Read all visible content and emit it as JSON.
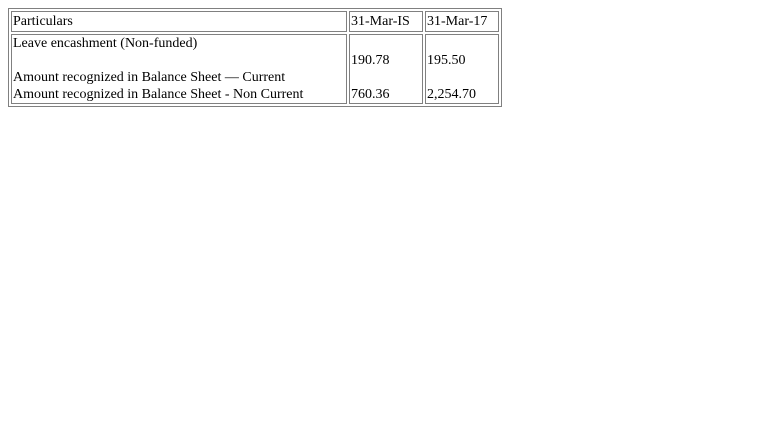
{
  "table": {
    "header": {
      "particulars": "Particulars",
      "col1": "31-Mar-IS",
      "col2": "31-Mar-17"
    },
    "section_label": "Leave encashment (Non-funded)",
    "rows": [
      {
        "label": "Amount recognized in Balance Sheet — Current",
        "col1": "190.78",
        "col2": "195.50"
      },
      {
        "label": "Amount recognized in Balance Sheet - Non Current",
        "col1": "760.36",
        "col2": "2,254.70"
      }
    ]
  }
}
